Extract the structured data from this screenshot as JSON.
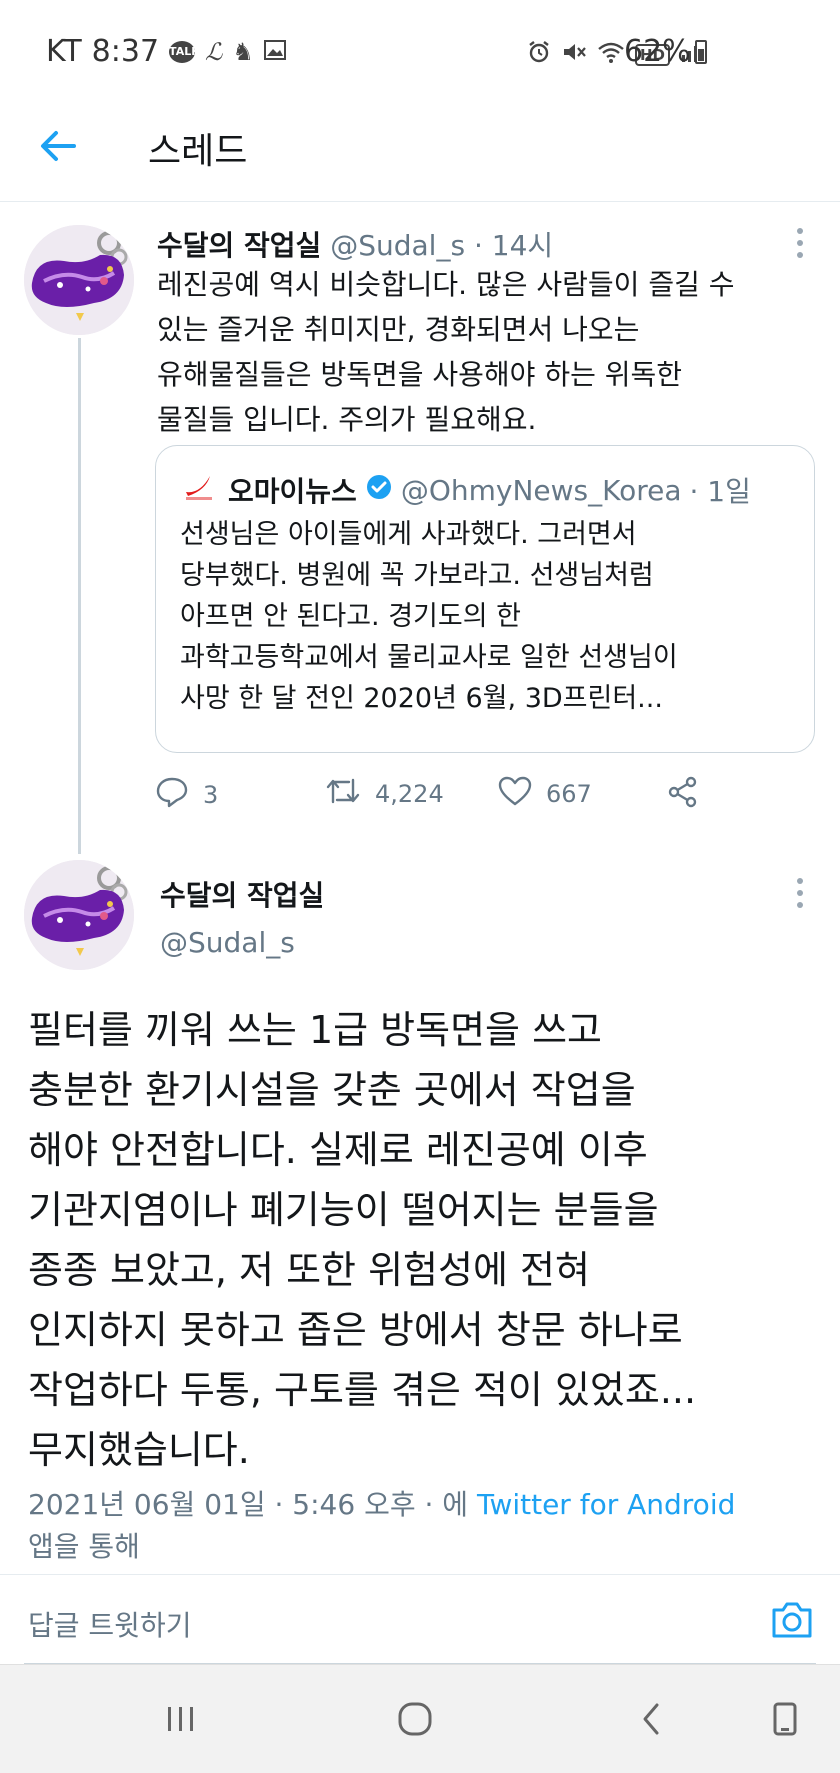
{
  "status_bar": {
    "carrier": "KT",
    "time": "8:37",
    "talk_badge": "TALK",
    "hd_badge": "HD",
    "battery": "62%"
  },
  "header": {
    "title": "스레드"
  },
  "first_tweet": {
    "name": "수달의 작업실",
    "handle": "@Sudal_s",
    "time": "· 14시",
    "text_lines": [
      "레진공예 역시 비슷합니다. 많은 사람들이 즐길 수",
      "있는 즐거운 취미지만, 경화되면서 나오는",
      "유해물질들은 방독면을 사용해야 하는 위독한",
      "물질들 입니다. 주의가 필요해요."
    ],
    "quote": {
      "name": "오마이뉴스",
      "handle": "@OhmyNews_Korea",
      "time": "· 1일",
      "text_lines": [
        "선생님은 아이들에게 사과했다. 그러면서",
        "당부했다. 병원에 꼭 가보라고. 선생님처럼",
        "아프면 안 된다고. 경기도의 한",
        "과학고등학교에서 물리교사로 일한 선생님이",
        "사망 한 달 전인 2020년 6월, 3D프린터..."
      ]
    },
    "actions": {
      "replies": "3",
      "retweets": "4,224",
      "likes": "667"
    }
  },
  "main_tweet": {
    "name": "수달의 작업실",
    "handle": "@Sudal_s",
    "text_lines": [
      "필터를 끼워 쓰는 1급 방독면을 쓰고",
      "충분한 환기시설을 갖춘 곳에서 작업을",
      "해야 안전합니다. 실제로 레진공예 이후",
      "기관지염이나 폐기능이 떨어지는 분들을",
      "종종 보았고, 저 또한 위험성에 전혀",
      "인지하지 못하고 좁은 방에서 창문 하나로",
      "작업하다 두통, 구토를 겪은 적이 있었죠...",
      "무지했습니다."
    ],
    "meta_date": "2021년 06월 01일 · 5:46 오후 · 에 ",
    "meta_source": "Twitter for Android",
    "meta_suffix": "앱을 통해"
  },
  "reply_bar": {
    "placeholder": "답글 트윗하기"
  },
  "colors": {
    "accent": "#1da1f2",
    "muted": "#657786",
    "border": "#ccd6dd"
  },
  "icons": [
    "back-arrow-icon",
    "more-vertical-icon",
    "verified-badge-icon",
    "reply-icon",
    "retweet-icon",
    "like-icon",
    "share-icon",
    "camera-icon",
    "recent-apps-icon",
    "home-icon",
    "nav-back-icon",
    "portrait-icon"
  ]
}
